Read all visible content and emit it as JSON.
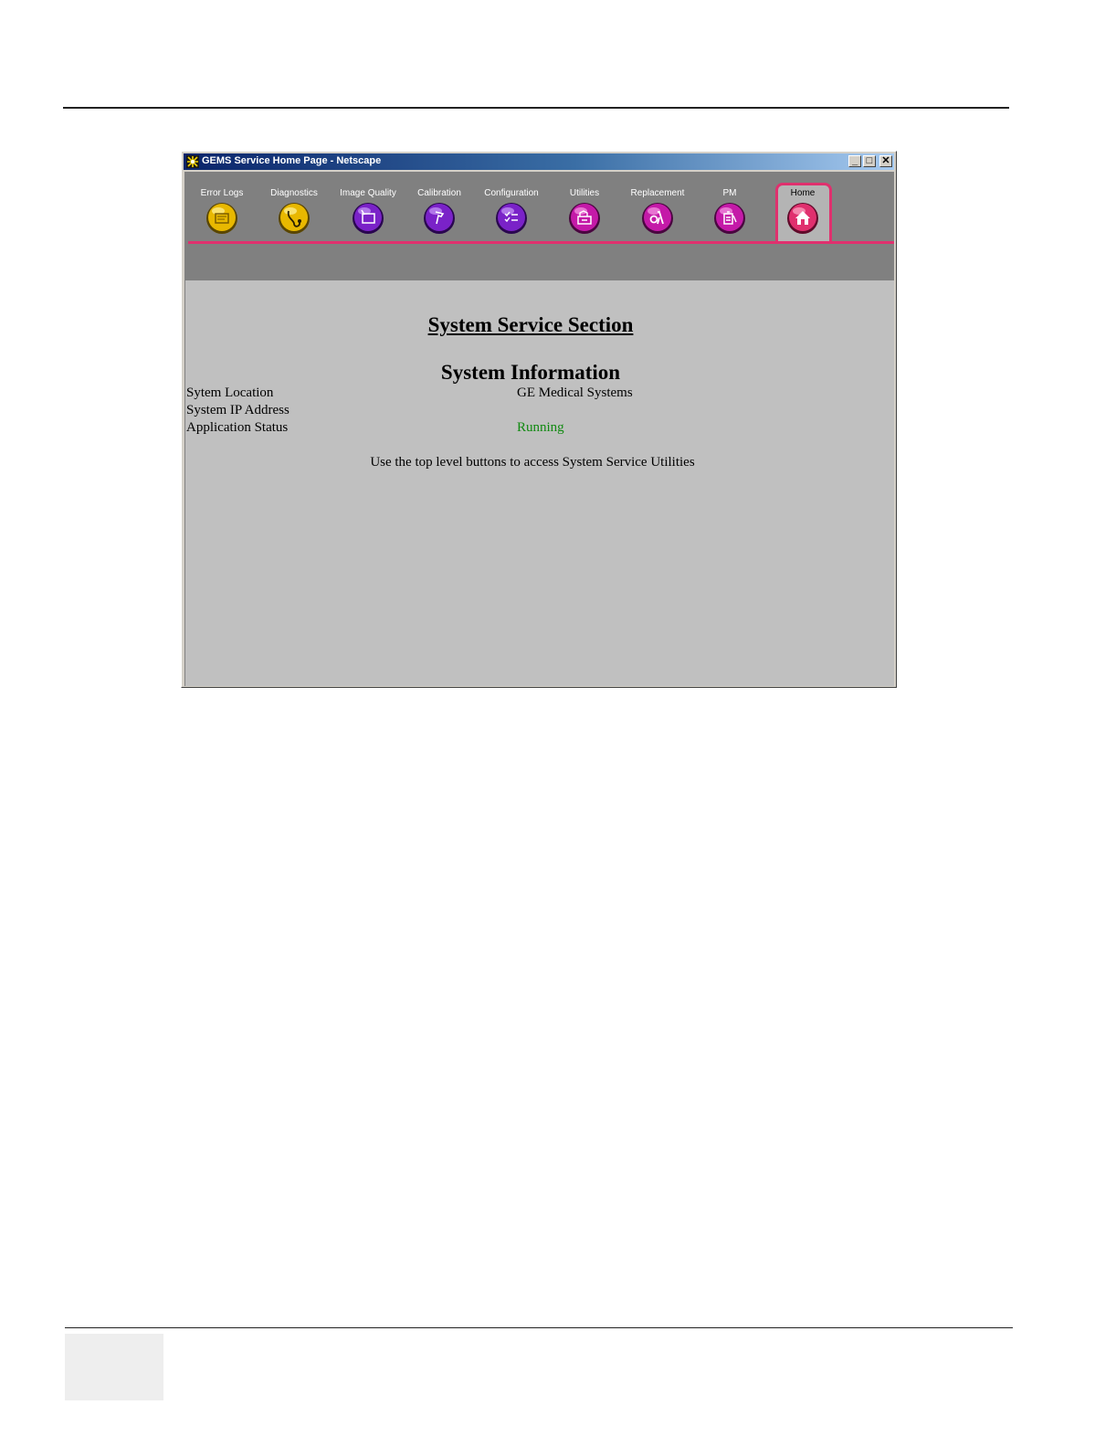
{
  "window": {
    "title": "GEMS Service Home Page - Netscape",
    "controls": {
      "minimize": "_",
      "maximize": "□",
      "close": "✕"
    }
  },
  "toolbar": {
    "accent_color": "#e0306e",
    "buttons": [
      {
        "label": "Error Logs",
        "icon": "error-log-icon",
        "color": "#e8b800"
      },
      {
        "label": "Diagnostics",
        "icon": "stethoscope-icon",
        "color": "#e8b800"
      },
      {
        "label": "Image Quality",
        "icon": "image-quality-icon",
        "color": "#7a22c8"
      },
      {
        "label": "Calibration",
        "icon": "calibration-icon",
        "color": "#7a22c8"
      },
      {
        "label": "Configuration",
        "icon": "configuration-icon",
        "color": "#7a22c8"
      },
      {
        "label": "Utilities",
        "icon": "utilities-icon",
        "color": "#c41aa8"
      },
      {
        "label": "Replacement",
        "icon": "replacement-icon",
        "color": "#c41aa8"
      },
      {
        "label": "PM",
        "icon": "pm-icon",
        "color": "#c41aa8"
      },
      {
        "label": "Home",
        "icon": "home-icon",
        "color": "#e0306e",
        "active": true
      }
    ]
  },
  "main": {
    "section_title": "System Service Section",
    "info_title": "System Information",
    "rows": [
      {
        "label": "Sytem Location",
        "value": "GE Medical Systems"
      },
      {
        "label": "System IP Address",
        "value": ""
      },
      {
        "label": "Application Status",
        "value": "Running",
        "value_color": "#118a11"
      }
    ],
    "hint": "Use the top level buttons to access System Service Utilities"
  }
}
